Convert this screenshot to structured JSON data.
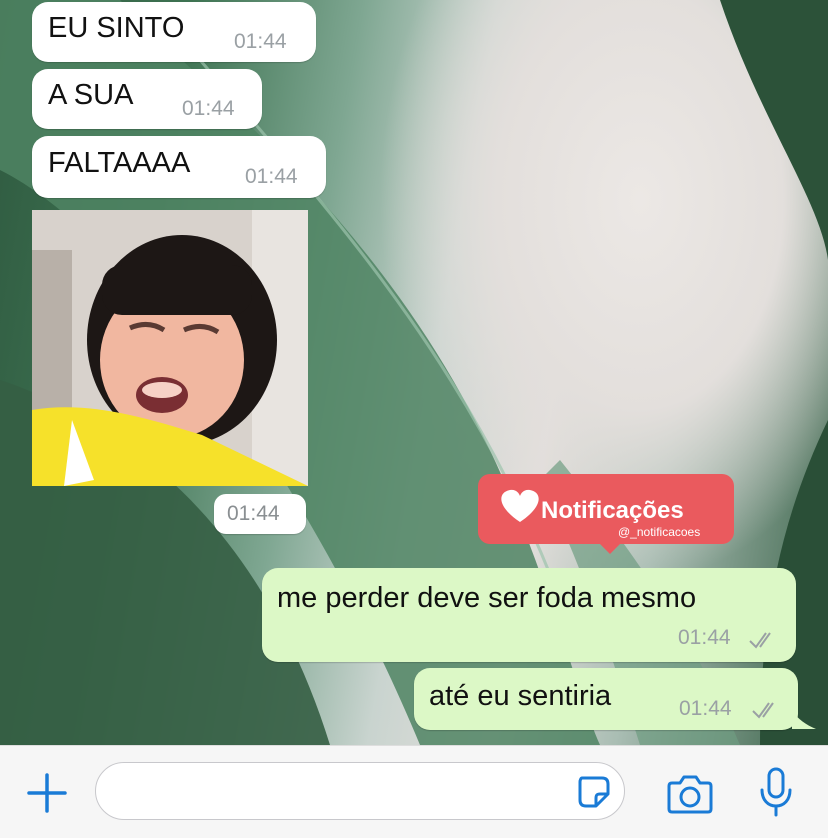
{
  "messages": [
    {
      "text": "EU SINTO",
      "time": "01:44",
      "direction": "incoming"
    },
    {
      "text": "A SUA",
      "time": "01:44",
      "direction": "incoming"
    },
    {
      "text": "FALTAAAA",
      "time": "01:44",
      "direction": "incoming"
    },
    {
      "image": "crying-child-photo",
      "time": "01:44",
      "direction": "incoming"
    },
    {
      "text": "me perder deve ser foda mesmo",
      "time": "01:44",
      "direction": "outgoing",
      "status": "read"
    },
    {
      "text": "até eu sentiria",
      "time": "01:44",
      "direction": "outgoing",
      "status": "read"
    }
  ],
  "watermark": {
    "title": "Notificações",
    "handle": "@_notificacoes",
    "color": "#ea5a5e"
  },
  "composer": {
    "input_value": "",
    "icons": [
      "plus-icon",
      "sticker-icon",
      "camera-icon",
      "microphone-icon"
    ],
    "accent": "#1a7bd6"
  },
  "colors": {
    "incoming_bubble": "#ffffff",
    "outgoing_bubble": "#dcf8c6"
  }
}
